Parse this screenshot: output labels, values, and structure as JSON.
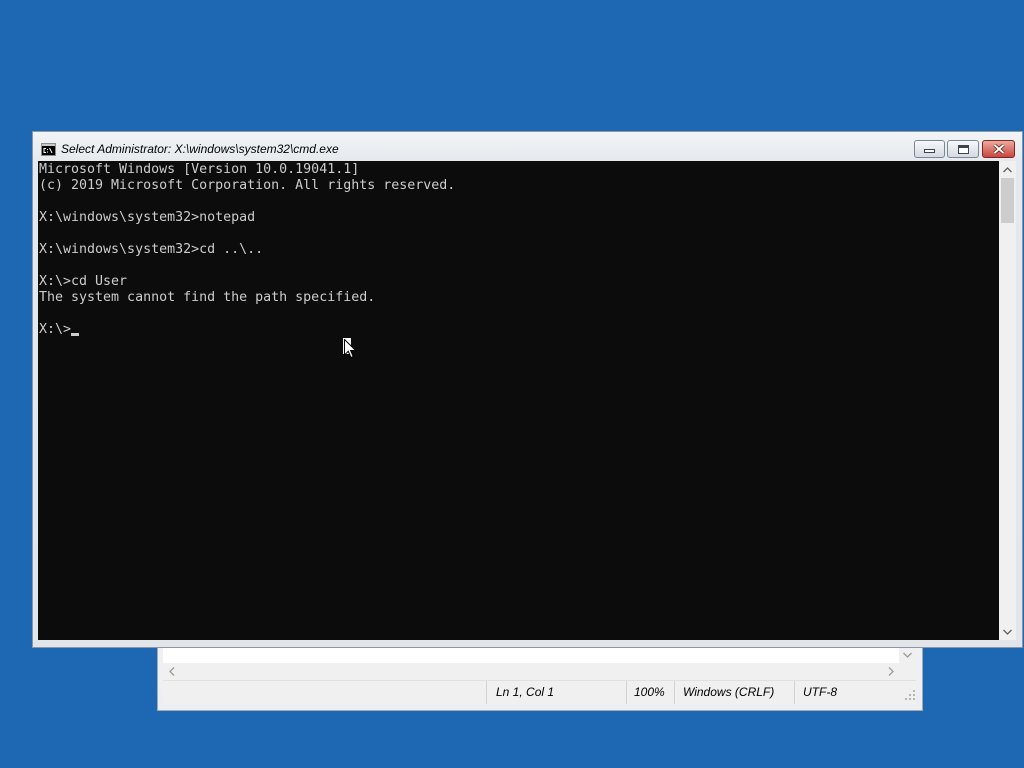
{
  "desktop": {
    "background": "#1e67b2"
  },
  "cmd_window": {
    "title": "Select Administrator: X:\\windows\\system32\\cmd.exe",
    "icon": "cmd-icon",
    "buttons": {
      "minimize_icon": "minimize-icon",
      "maximize_icon": "maximize-icon",
      "close_icon": "close-icon"
    },
    "console": {
      "background": "#0c0c0c",
      "foreground": "#cccccc",
      "lines": [
        "Microsoft Windows [Version 10.0.19041.1]",
        "(c) 2019 Microsoft Corporation. All rights reserved.",
        "",
        "X:\\windows\\system32>notepad",
        "",
        "X:\\windows\\system32>cd ..\\..",
        "",
        "X:\\>cd User",
        "The system cannot find the path specified.",
        "",
        "X:\\>"
      ]
    },
    "scrollbar": {
      "up_icon": "chevron-up-icon",
      "down_icon": "chevron-down-icon"
    }
  },
  "notepad_window": {
    "scrollbars": {
      "down_icon": "chevron-down-icon",
      "left_icon": "chevron-left-icon",
      "right_icon": "chevron-right-icon"
    },
    "status_bar": {
      "position": "Ln 1, Col 1",
      "zoom": "100%",
      "line_ending": "Windows (CRLF)",
      "encoding": "UTF-8"
    }
  },
  "pointer": {
    "icon": "mouse-pointer-icon"
  },
  "colors": {
    "close_button": "#c9473c",
    "scrollbar_track": "#f0f0f0",
    "scrollbar_thumb": "#cdcdcd"
  }
}
